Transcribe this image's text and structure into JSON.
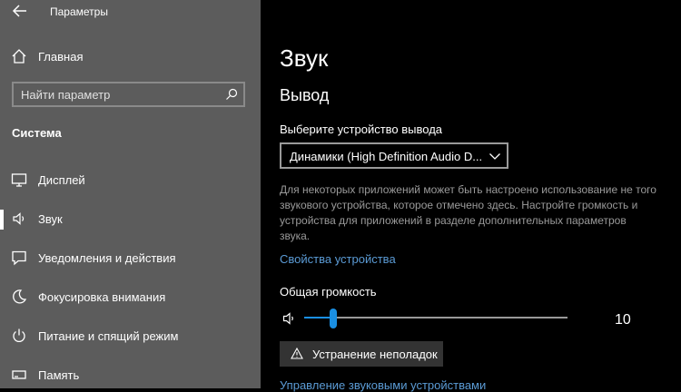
{
  "window": {
    "title": "Параметры"
  },
  "sidebar": {
    "home_label": "Главная",
    "search_placeholder": "Найти параметр",
    "section_heading": "Система",
    "items": [
      {
        "label": "Дисплей",
        "icon": "display-icon"
      },
      {
        "label": "Звук",
        "icon": "speaker-icon",
        "active": true
      },
      {
        "label": "Уведомления и действия",
        "icon": "notifications-icon"
      },
      {
        "label": "Фокусировка внимания",
        "icon": "moon-icon"
      },
      {
        "label": "Питание и спящий режим",
        "icon": "power-icon"
      },
      {
        "label": "Память",
        "icon": "storage-icon"
      }
    ]
  },
  "main": {
    "title": "Звук",
    "output_heading": "Вывод",
    "device_label": "Выберите устройство вывода",
    "device_value": "Динамики (High Definition Audio D...",
    "info_text": "Для некоторых приложений может быть настроено использование не того звукового устройства, которое отмечено здесь. Настройте громкость и устройства для приложений в разделе дополнительных параметров звука.",
    "device_properties_link": "Свойства устройства",
    "volume_label": "Общая громкость",
    "volume_value": "10",
    "volume_percent": 10,
    "troubleshoot_label": "Устранение неполадок",
    "manage_devices_link": "Управление звуковыми устройствами"
  },
  "colors": {
    "sidebar_bg": "#5c5c5c",
    "main_bg": "#000000",
    "accent": "#1a8fe3",
    "link": "#5b9bd5"
  }
}
